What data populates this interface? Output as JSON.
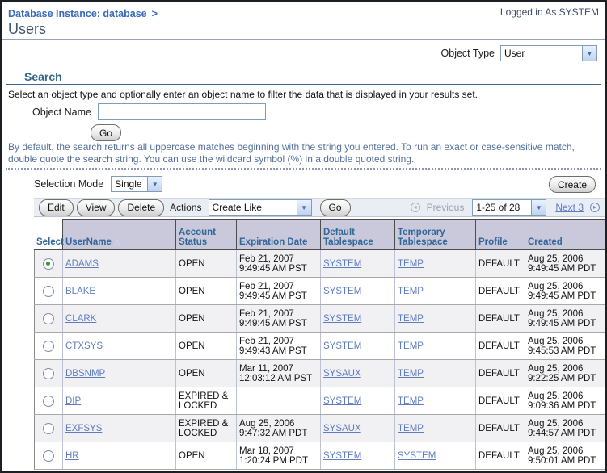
{
  "header": {
    "breadcrumb": "Database Instance: database",
    "breadcrumb_separator": ">",
    "logged_in": "Logged in As SYSTEM",
    "page_title": "Users"
  },
  "object_type": {
    "label": "Object Type",
    "value": "User"
  },
  "search": {
    "title": "Search",
    "description": "Select an object type and optionally enter an object name to filter the data that is displayed in your results set.",
    "object_name_label": "Object Name",
    "object_name_value": "",
    "go_label": "Go",
    "hint": "By default, the search returns all uppercase matches beginning with the string you entered. To run an exact or case-sensitive match, double quote the search string. You can use the wildcard symbol (%) in a double quoted string."
  },
  "selection": {
    "label": "Selection Mode",
    "value": "Single",
    "create_label": "Create"
  },
  "toolbar": {
    "edit_label": "Edit",
    "view_label": "View",
    "delete_label": "Delete",
    "actions_label": "Actions",
    "actions_value": "Create Like",
    "go_label": "Go",
    "previous_label": "Previous",
    "previous_disabled": true,
    "range_value": "1-25 of 28",
    "next_label": "Next 3"
  },
  "table": {
    "columns": [
      "Select",
      "UserName",
      "Account Status",
      "Expiration Date",
      "Default Tablespace",
      "Temporary Tablespace",
      "Profile",
      "Created"
    ],
    "sort": {
      "column": "UserName",
      "direction": "ascending"
    },
    "rows": [
      {
        "selected": true,
        "username": "ADAMS",
        "account_status": "OPEN",
        "expiration_date": "Feb 21, 2007 9:49:45 AM PST",
        "default_tablespace": "SYSTEM",
        "temporary_tablespace": "TEMP",
        "profile": "DEFAULT",
        "created": "Aug 25, 2006 9:49:45 AM PDT"
      },
      {
        "selected": false,
        "username": "BLAKE",
        "account_status": "OPEN",
        "expiration_date": "Feb 21, 2007 9:49:45 AM PST",
        "default_tablespace": "SYSTEM",
        "temporary_tablespace": "TEMP",
        "profile": "DEFAULT",
        "created": "Aug 25, 2006 9:49:45 AM PDT"
      },
      {
        "selected": false,
        "username": "CLARK",
        "account_status": "OPEN",
        "expiration_date": "Feb 21, 2007 9:49:45 AM PST",
        "default_tablespace": "SYSTEM",
        "temporary_tablespace": "TEMP",
        "profile": "DEFAULT",
        "created": "Aug 25, 2006 9:49:45 AM PDT"
      },
      {
        "selected": false,
        "username": "CTXSYS",
        "account_status": "OPEN",
        "expiration_date": "Feb 21, 2007 9:49:43 AM PST",
        "default_tablespace": "SYSTEM",
        "temporary_tablespace": "TEMP",
        "profile": "DEFAULT",
        "created": "Aug 25, 2006 9:45:53 AM PDT"
      },
      {
        "selected": false,
        "username": "DBSNMP",
        "account_status": "OPEN",
        "expiration_date": "Mar 11, 2007 12:03:12 AM PST",
        "default_tablespace": "SYSAUX",
        "temporary_tablespace": "TEMP",
        "profile": "DEFAULT",
        "created": "Aug 25, 2006 9:22:25 AM PDT"
      },
      {
        "selected": false,
        "username": "DIP",
        "account_status": "EXPIRED & LOCKED",
        "expiration_date": "",
        "default_tablespace": "SYSTEM",
        "temporary_tablespace": "TEMP",
        "profile": "DEFAULT",
        "created": "Aug 25, 2006 9:09:36 AM PDT"
      },
      {
        "selected": false,
        "username": "EXFSYS",
        "account_status": "EXPIRED & LOCKED",
        "expiration_date": "Aug 25, 2006 9:47:32 AM PDT",
        "default_tablespace": "SYSAUX",
        "temporary_tablespace": "TEMP",
        "profile": "DEFAULT",
        "created": "Aug 25, 2006 9:44:57 AM PDT"
      },
      {
        "selected": false,
        "username": "HR",
        "account_status": "OPEN",
        "expiration_date": "Mar 18, 2007 1:20:24 PM PDT",
        "default_tablespace": "SYSTEM",
        "temporary_tablespace": "SYSTEM",
        "profile": "DEFAULT",
        "created": "Aug 25, 2006 9:50:01 AM PDT"
      }
    ]
  },
  "colors": {
    "link": "#5f7dbe",
    "breadcrumb_link": "#3a6cb5",
    "table_header_bg": "#c9c9db",
    "table_header_text": "#336699",
    "toolbar_bg": "#e9edf4",
    "selected_radio": "#2d9e2d",
    "row_stripe": "#f1f1f4"
  }
}
